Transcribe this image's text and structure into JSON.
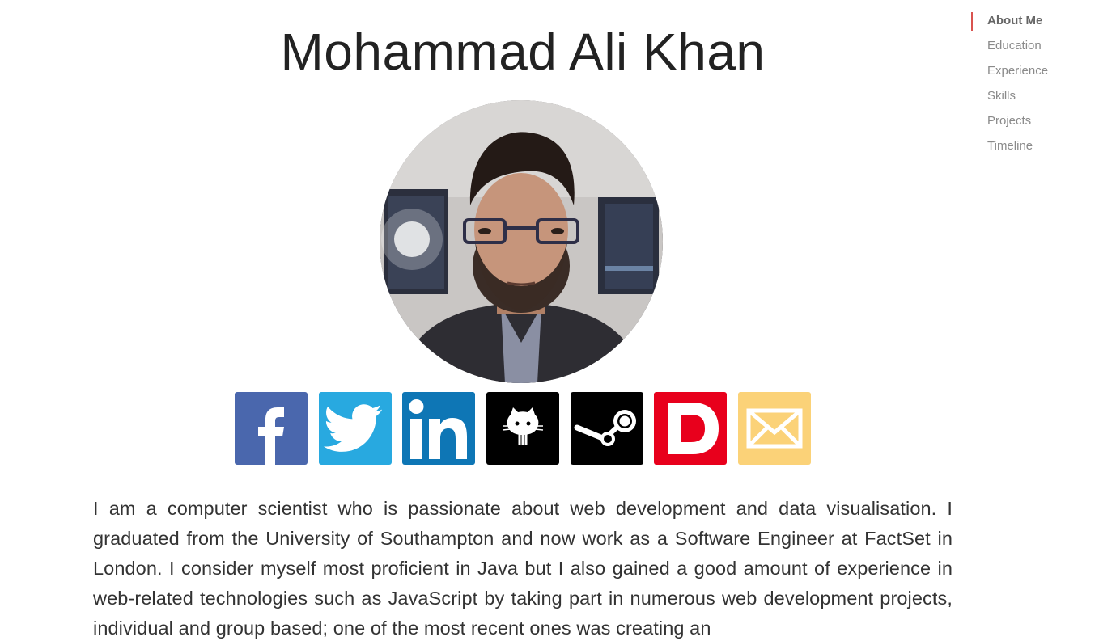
{
  "header": {
    "name": "Mohammad Ali Khan"
  },
  "nav": {
    "items": [
      {
        "label": "About Me",
        "active": true
      },
      {
        "label": "Education",
        "active": false
      },
      {
        "label": "Experience",
        "active": false
      },
      {
        "label": "Skills",
        "active": false
      },
      {
        "label": "Projects",
        "active": false
      },
      {
        "label": "Timeline",
        "active": false
      }
    ],
    "accent_color": "#d9534f"
  },
  "social": [
    {
      "icon": "facebook-icon",
      "color": "#4a67ad"
    },
    {
      "icon": "twitter-icon",
      "color": "#28a9e0"
    },
    {
      "icon": "linkedin-icon",
      "color": "#0e76b5"
    },
    {
      "icon": "github-icon",
      "color": "#000000"
    },
    {
      "icon": "steam-icon",
      "color": "#000000"
    },
    {
      "icon": "dev-icon",
      "color": "#e8001c"
    },
    {
      "icon": "email-icon",
      "color": "#fbd278"
    }
  ],
  "about": {
    "bio": "I am a computer scientist who is passionate about web development and data visualisation. I graduated from the University of Southampton and now work as a Software Engineer at FactSet in London. I consider myself most proficient in Java but I also gained a good amount of experience in web-related technologies such as JavaScript by taking part in numerous web development projects, individual and group based; one of the most recent ones was creating an"
  }
}
